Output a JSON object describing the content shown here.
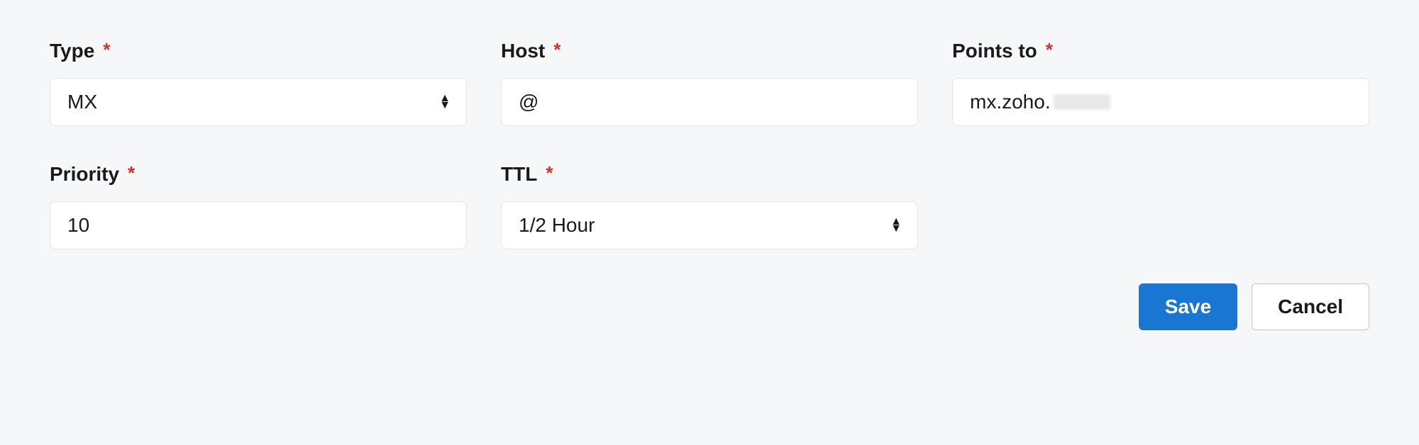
{
  "fields": {
    "type": {
      "label": "Type",
      "value": "MX",
      "required": true
    },
    "host": {
      "label": "Host",
      "value": "@",
      "required": true
    },
    "points_to": {
      "label": "Points to",
      "value": "mx.zoho.",
      "required": true
    },
    "priority": {
      "label": "Priority",
      "value": "10",
      "required": true
    },
    "ttl": {
      "label": "TTL",
      "value": "1/2 Hour",
      "required": true
    }
  },
  "buttons": {
    "save": "Save",
    "cancel": "Cancel"
  },
  "required_marker": "*"
}
